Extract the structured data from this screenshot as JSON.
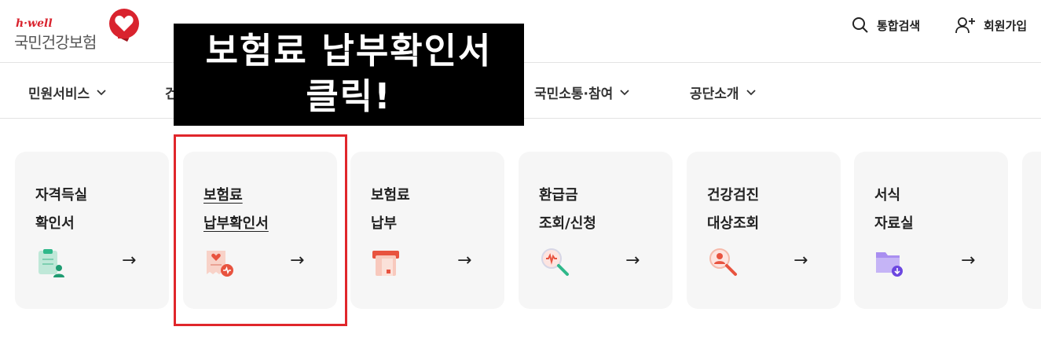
{
  "header": {
    "logo_small": "h·well",
    "logo_main": "국민건강보험",
    "search_label": "통합검색",
    "join_label": "회원가입"
  },
  "gnb": {
    "items": [
      {
        "label": "민원서비스"
      },
      {
        "label": "건"
      },
      {
        "label": "국민소통·참여"
      },
      {
        "label": "공단소개"
      }
    ]
  },
  "overlay": {
    "line1": "보험료 납부확인서",
    "line2": "클릭!"
  },
  "cards": [
    {
      "line1": "자격득실",
      "line2": "확인서",
      "icon": "certificate-user-icon",
      "arrow": "→"
    },
    {
      "line1": "보험료",
      "line2": "납부확인서",
      "icon": "receipt-heart-icon",
      "arrow": "→"
    },
    {
      "line1": "보험료",
      "line2": "납부",
      "icon": "payment-card-icon",
      "arrow": "→"
    },
    {
      "line1": "환급금",
      "line2": "조회/신청",
      "icon": "search-won-icon",
      "arrow": "→"
    },
    {
      "line1": "건강검진",
      "line2": "대상조회",
      "icon": "search-person-icon",
      "arrow": "→"
    },
    {
      "line1": "서식",
      "line2": "자료실",
      "icon": "folder-download-icon",
      "arrow": "→"
    }
  ],
  "colors": {
    "brand_red": "#d9232e",
    "highlight_red": "#e0262b",
    "card_bg": "#f6f6f6"
  }
}
